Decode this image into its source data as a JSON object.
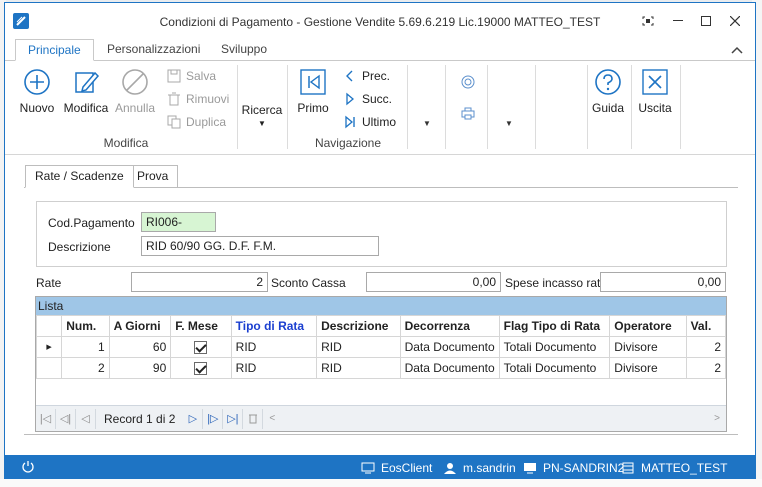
{
  "window": {
    "title": "Condizioni di Pagamento - Gestione Vendite 5.69.6.219 Lic.19000 MATTEO_TEST"
  },
  "ribbon_tabs": [
    "Principale",
    "Personalizzazioni",
    "Sviluppo"
  ],
  "ribbon": {
    "nuovo": "Nuovo",
    "modifica": "Modifica",
    "annulla": "Annulla",
    "salva": "Salva",
    "rimuovi": "Rimuovi",
    "duplica": "Duplica",
    "group_modifica": "Modifica",
    "ricerca": "Ricerca",
    "primo": "Primo",
    "prec": "Prec.",
    "succ": "Succ.",
    "ultimo": "Ultimo",
    "group_navigazione": "Navigazione",
    "guida": "Guida",
    "uscita": "Uscita"
  },
  "page_tabs": [
    "Rate / Scadenze",
    "Prova"
  ],
  "form": {
    "cod_label": "Cod.Pagamento",
    "cod_value": "RI006-",
    "desc_label": "Descrizione",
    "desc_value": "RID 60/90 GG. D.F. F.M.",
    "rate_label": "Rate",
    "rate_value": "2",
    "sconto_label": "Sconto Cassa",
    "sconto_value": "0,00",
    "spese_label": "Spese incasso rata",
    "spese_value": "0,00"
  },
  "list": {
    "title": "Lista",
    "columns": [
      "Num.",
      "A Giorni",
      "F. Mese",
      "Tipo di Rata",
      "Descrizione",
      "Decorrenza",
      "Flag Tipo di Rata",
      "Operatore",
      "Val."
    ],
    "rows": [
      {
        "num": "1",
        "giorni": "60",
        "fmese": true,
        "tipo": "RID",
        "descr": "RID",
        "decorrenza": "Data Documento",
        "flag": "Totali Documento",
        "operatore": "Divisore",
        "val": "2"
      },
      {
        "num": "2",
        "giorni": "90",
        "fmese": true,
        "tipo": "RID",
        "descr": "RID",
        "decorrenza": "Data Documento",
        "flag": "Totali Documento",
        "operatore": "Divisore",
        "val": "2"
      }
    ],
    "record_text": "Record 1 di 2"
  },
  "statusbar": {
    "client": "EosClient",
    "user": "m.sandrin",
    "machine": "PN-SANDRIN2",
    "db": "MATTEO_TEST"
  },
  "colors": {
    "accent": "#1e74c4",
    "list_header": "#9fc6e7",
    "code_field": "#d7f5d3",
    "highlight_column": "#1b3fd0"
  }
}
